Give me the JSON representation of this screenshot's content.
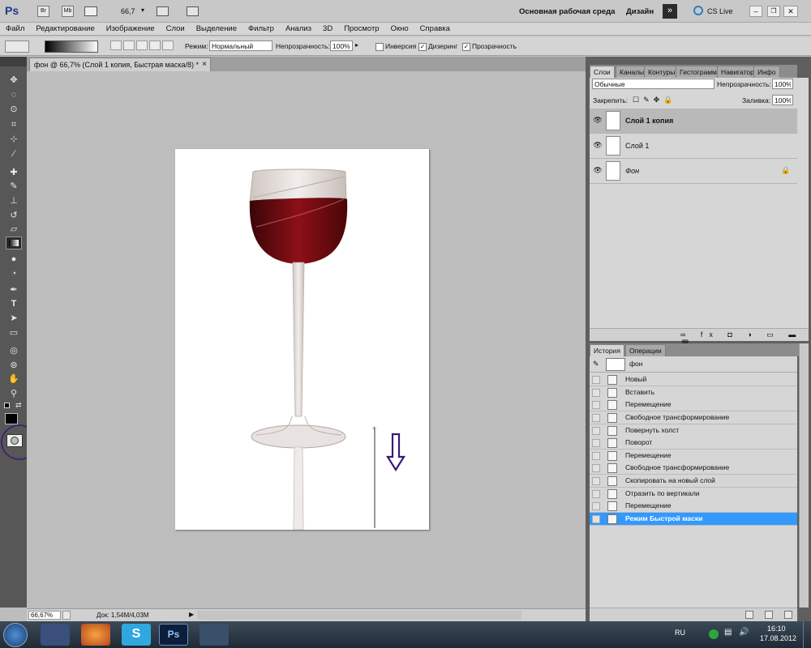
{
  "appbar": {
    "logo": "Ps",
    "br": "Br",
    "mb": "Mb",
    "zoom": "66,7",
    "workspace": "Основная рабочая среда",
    "design": "Дизайн",
    "cslive": "CS Live"
  },
  "menu": [
    "Файл",
    "Редактирование",
    "Изображение",
    "Слои",
    "Выделение",
    "Фильтр",
    "Анализ",
    "3D",
    "Просмотр",
    "Окно",
    "Справка"
  ],
  "options": {
    "mode_label": "Режим:",
    "mode_value": "Нормальный",
    "opacity_label": "Непрозрачность:",
    "opacity_value": "100%",
    "inversion": "Инверсия",
    "dither": "Дизеринг",
    "transparency": "Прозрачность"
  },
  "document": {
    "tab_title": "фон @ 66,7% (Слой 1 копия, Быстрая маска/8) *",
    "close": "×"
  },
  "status": {
    "zoom": "66,67%",
    "doc": "Док: 1,54M/4,03M"
  },
  "layers_panel": {
    "tabs": [
      "Слои",
      "Каналы",
      "Контуры",
      "Гистограмма",
      "Навигатор",
      "Инфо"
    ],
    "blend_mode": "Обычные",
    "opacity_label": "Непрозрачность:",
    "opacity_value": "100%",
    "lock_label": "Закрепить:",
    "fill_label": "Заливка:",
    "fill_value": "100%",
    "layers": [
      {
        "name": "Слой 1 копия",
        "selected": true
      },
      {
        "name": "Слой 1",
        "selected": false
      },
      {
        "name": "Фон",
        "selected": false
      }
    ]
  },
  "history_panel": {
    "tabs": [
      "История",
      "Операции"
    ],
    "snapshot": "фон",
    "items": [
      "Новый",
      "Вставить",
      "Перемещение",
      "Свободное трансформирование",
      "Повернуть холст",
      "Поворот",
      "Перемещение",
      "Свободное трансформирование",
      "Скопировать на новый слой",
      "Отразить по вертикали",
      "Перемещение",
      "Режим Быстрой маски"
    ],
    "active_index": 11
  },
  "taskbar": {
    "lang": "RU",
    "time": "16:10",
    "date": "17.08.2012",
    "ps_label": "Ps"
  },
  "colors": {
    "accent": "#3399ff",
    "annotation": "#3a1a78",
    "wine": "#7a0f14"
  },
  "icons": [
    "move-icon",
    "lasso-icon",
    "quick-select-icon",
    "crop-icon",
    "eyedropper-icon",
    "healing-icon",
    "brush-icon",
    "stamp-icon",
    "history-brush-icon",
    "eraser-icon",
    "gradient-icon",
    "blur-icon",
    "dodge-icon",
    "pen-icon",
    "type-icon",
    "path-select-icon",
    "rectangle-icon",
    "3d-rotate-icon",
    "3d-orbit-icon",
    "hand-icon",
    "zoom-icon",
    "quick-mask-icon"
  ]
}
